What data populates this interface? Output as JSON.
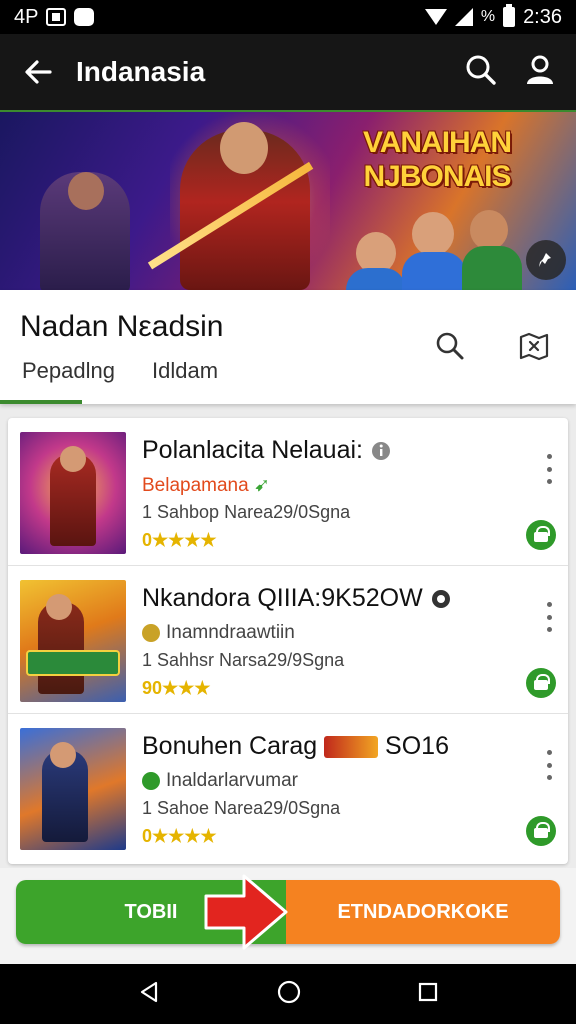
{
  "status_bar": {
    "carrier": "4P",
    "time": "2:36",
    "percent_glyph": "%"
  },
  "app_bar": {
    "title": "Indanasia"
  },
  "banner": {
    "logo_line1": "VANAIHAN",
    "logo_line2": "NJBONAIS"
  },
  "header": {
    "title": "Nadan Nεadsin",
    "tabs": [
      {
        "label": "Pepadlng"
      },
      {
        "label": "Idldam"
      }
    ]
  },
  "items": [
    {
      "title": "Polanlacita Nelauai:",
      "subtitle": "Belapamana",
      "subtitle_color": "#e24a1c",
      "meta": "1 Sahbop Narea29/0Sgna",
      "rating": "0★★★★",
      "title_icon": "info-icon"
    },
    {
      "title": "Nkandora QIIIA:9K52OW",
      "subtitle": "Inamndraawtiin",
      "subtitle_color": "#444444",
      "meta": "1 Sahhsr Narsa29/9Sgna",
      "rating": "90★★★",
      "title_icon": "record-icon"
    },
    {
      "title": "Bonuhen Carag",
      "title_extra": "SO16",
      "subtitle": "Inaldarlarvumar",
      "subtitle_color": "#444444",
      "meta": "1 Sahoe Narea29/0Sgna",
      "rating": "0★★★★",
      "title_icon": "chest-icon"
    }
  ],
  "cta": {
    "left_label": "TOBII",
    "right_label": "ETNDADORKOKE"
  },
  "colors": {
    "accent_green": "#3da42b",
    "accent_orange": "#f58220",
    "rating_yellow": "#e5b400"
  }
}
